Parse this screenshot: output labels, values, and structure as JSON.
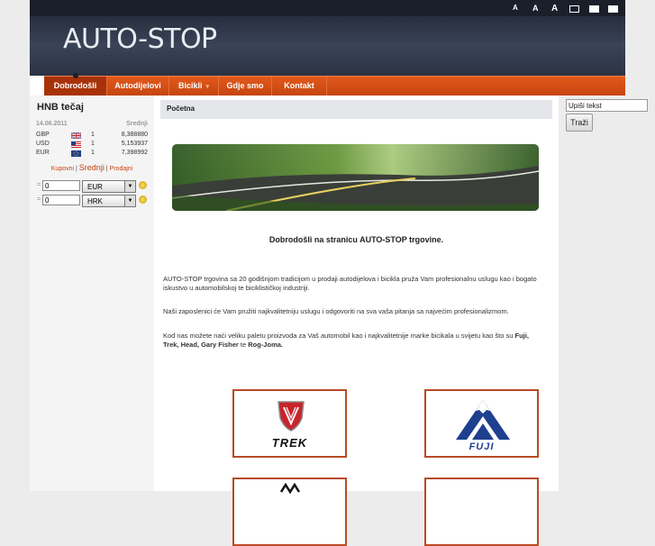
{
  "header": {
    "logo": "AUTO-STOP",
    "font_sizes": [
      "A",
      "A",
      "A"
    ]
  },
  "nav": {
    "items": [
      {
        "label": "Dobrodošli",
        "active": true
      },
      {
        "label": "Autodijelovi",
        "active": false
      },
      {
        "label": "Bicikli",
        "active": false,
        "has_submenu": true
      },
      {
        "label": "Gdje smo",
        "active": false
      },
      {
        "label": "Kontakt",
        "active": false
      }
    ],
    "submenu_arrow": "▾"
  },
  "hnb": {
    "title": "HNB tečaj",
    "date": "14.06.2011",
    "rate_type": "Srednji",
    "rates": [
      {
        "code": "GBP",
        "flag": "uk-flag-icon",
        "unit": "1",
        "value": "8,388880"
      },
      {
        "code": "USD",
        "flag": "us-flag-icon",
        "unit": "1",
        "value": "5,153937"
      },
      {
        "code": "EUR",
        "flag": "eu-flag-icon",
        "unit": "1",
        "value": "7,398992"
      }
    ],
    "toggle": {
      "buy": "Kupovni",
      "mid": "Srednji",
      "sell": "Prodajni",
      "sep": "|"
    },
    "converter": [
      {
        "eq": "=",
        "amount": "0",
        "currency": "EUR"
      },
      {
        "eq": "=",
        "amount": "0",
        "currency": "HRK"
      }
    ]
  },
  "main": {
    "breadcrumb": "Početna",
    "welcome": "Dobrodošli na stranicu AUTO-STOP trgovine.",
    "p1": "AUTO-STOP trgovina sa 20 godišnjom tradicijom u prodaji autodijelova i bicikla pruža Vam profesionalnu uslugu kao i bogato iskustvo u automobilskoj te biciklističkoj industriji.",
    "p2": "Naši zaposlenici će Vam pružiti najkvalitetniju uslugu i odgovoriti na sva vaša pitanja sa najvećim profesionalizmom.",
    "p3_pre": "Kod nas možete naći veliku paletu proizvoda za Vaš automobil kao i najkvalitetnije marke bicikala u svijetu kao što su ",
    "p3_brands": "Fuji, Trek, Head, Gary Fisher",
    "p3_mid": " te ",
    "p3_last": "Rog-Joma.",
    "brands": [
      "TREK",
      "FUJI"
    ]
  },
  "search": {
    "placeholder": "Upiši tekst",
    "value": "Upiši tekst",
    "button": "Traži"
  },
  "colors": {
    "nav": "#d4501a",
    "header": "#2b3344",
    "brand_border": "#b84a25",
    "trek_red": "#c8242b",
    "fuji_blue": "#1f3f8f"
  }
}
